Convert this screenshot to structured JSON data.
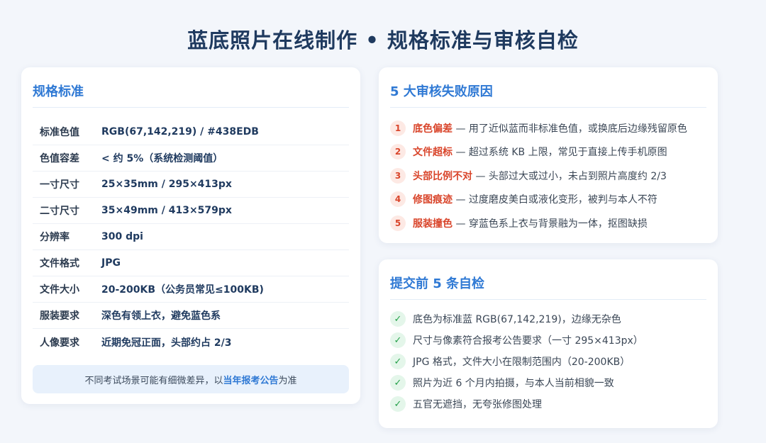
{
  "page": {
    "title": "蓝底照片在线制作 • 规格标准与审核自检"
  },
  "colors": {
    "accent": "#2f79d4",
    "warning": "#d9452b",
    "success": "#24a148",
    "background": "#f3f6fb"
  },
  "spec": {
    "title": "规格标准",
    "rows": [
      {
        "key": "标准色值",
        "value": "RGB(67,142,219) / #438EDB"
      },
      {
        "key": "色值容差",
        "value": "< 约 5%（系统检测阈值）"
      },
      {
        "key": "一寸尺寸",
        "value": "25×35mm / 295×413px"
      },
      {
        "key": "二寸尺寸",
        "value": "35×49mm / 413×579px"
      },
      {
        "key": "分辨率",
        "value": "300 dpi"
      },
      {
        "key": "文件格式",
        "value": "JPG"
      },
      {
        "key": "文件大小",
        "value": "20-200KB（公务员常见≤100KB)"
      },
      {
        "key": "服装要求",
        "value": "深色有领上衣，避免蓝色系"
      },
      {
        "key": "人像要求",
        "value": "近期免冠正面，头部约占 2/3"
      }
    ],
    "note": {
      "prefix": "不同考试场景可能有细微差异，以",
      "emphasis": "当年报考公告",
      "suffix": "为准"
    }
  },
  "fail": {
    "title": "5 大审核失败原因",
    "items": [
      {
        "num": "1",
        "head": "底色偏差",
        "text": " — 用了近似蓝而非标准色值，或换底后边缘残留原色"
      },
      {
        "num": "2",
        "head": "文件超标",
        "text": " — 超过系统 KB 上限，常见于直接上传手机原图"
      },
      {
        "num": "3",
        "head": "头部比例不对",
        "text": " — 头部过大或过小，未占到照片高度约 2/3"
      },
      {
        "num": "4",
        "head": "修图痕迹",
        "text": " — 过度磨皮美白或液化变形，被判与本人不符"
      },
      {
        "num": "5",
        "head": "服装撞色",
        "text": " — 穿蓝色系上衣与背景融为一体，抠图缺损"
      }
    ]
  },
  "check": {
    "title": "提交前 5 条自检",
    "icon": "✓",
    "items": [
      {
        "text": "底色为标准蓝 RGB(67,142,219)，边缘无杂色"
      },
      {
        "text": "尺寸与像素符合报考公告要求（一寸 295×413px）"
      },
      {
        "text": "JPG 格式，文件大小在限制范围内（20-200KB）"
      },
      {
        "text": "照片为近 6 个月内拍摄，与本人当前相貌一致"
      },
      {
        "text": "五官无遮挡，无夸张修图处理"
      }
    ]
  }
}
